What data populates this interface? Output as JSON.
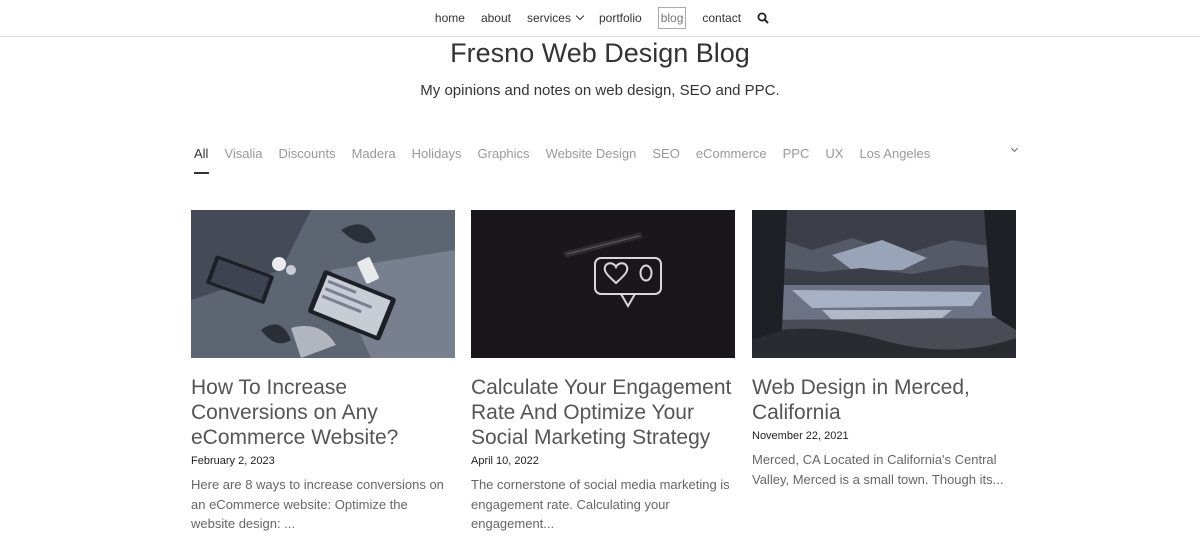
{
  "nav": {
    "items": [
      {
        "label": "home"
      },
      {
        "label": "about"
      },
      {
        "label": "services"
      },
      {
        "label": "portfolio"
      },
      {
        "label": "blog"
      },
      {
        "label": "contact"
      }
    ],
    "search_icon": "search-icon"
  },
  "hero": {
    "title": "Fresno Web Design Blog",
    "subtitle": "My opinions and notes on web design, SEO and PPC."
  },
  "filters": {
    "items": [
      "All",
      "Visalia",
      "Discounts",
      "Madera",
      "Holidays",
      "Graphics",
      "Website Design",
      "SEO",
      "eCommerce",
      "PPC",
      "UX",
      "Los Angeles"
    ],
    "active": "All",
    "more_icon": "chevron-down-icon"
  },
  "posts": [
    {
      "title": "How To Increase Conversions on Any eCommerce Website?",
      "date": "February 2, 2023",
      "excerpt": "Here are 8 ways to increase conversions on an eCommerce website: Optimize the website design: ..."
    },
    {
      "title": "Calculate Your Engagement Rate And Optimize Your Social Marketing Strategy",
      "date": "April 10, 2022",
      "excerpt": "The cornerstone of social media marketing is engagement rate. Calculating your engagement..."
    },
    {
      "title": "Web Design in Merced, California",
      "date": "November 22, 2021",
      "excerpt": "Merced, CA Located in California's Central Valley, Merced is a small town. Though its..."
    }
  ],
  "colors": {
    "accent": "#333333",
    "muted": "#999999"
  }
}
